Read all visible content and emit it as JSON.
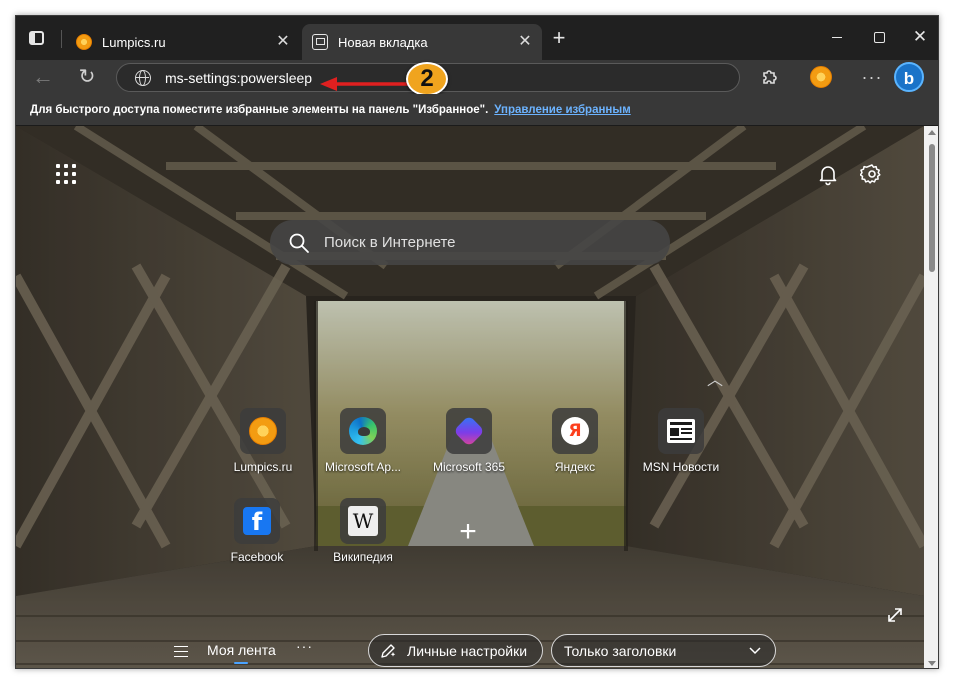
{
  "tabs": [
    {
      "title": "Lumpics.ru",
      "close": "✕",
      "favicon": "orange-icon"
    },
    {
      "title": "Новая вкладка",
      "close": "✕",
      "favicon": "new-tab-icon",
      "active": true
    }
  ],
  "toolbar": {
    "address_value": "ms-settings:powersleep",
    "annotation_number": "2",
    "annotation_color": "#f0a41e",
    "arrow_color": "#e02020",
    "bing_label": "b",
    "more_label": "···"
  },
  "favorites_bar": {
    "message": "Для быстрого доступа поместите избранные элементы на панель \"Избранное\".",
    "link": "Управление избранным"
  },
  "new_tab": {
    "search_placeholder": "Поиск в Интернете",
    "quick_links": [
      {
        "label": "Lumpics.ru",
        "icon": "orange-icon"
      },
      {
        "label": "Microsoft Ap...",
        "icon": "edge-icon"
      },
      {
        "label": "Microsoft 365",
        "icon": "microsoft-365-icon"
      },
      {
        "label": "Яндекс",
        "icon": "yandex-icon",
        "glyph": "Я"
      },
      {
        "label": "MSN Новости",
        "icon": "msn-news-icon"
      },
      {
        "label": "Facebook",
        "icon": "facebook-icon",
        "glyph": "f"
      },
      {
        "label": "Википедия",
        "icon": "wikipedia-icon",
        "glyph": "W"
      }
    ],
    "add_site": "+",
    "feed": {
      "menu_label": "Моя лента",
      "more": "···",
      "personalize": "Личные настройки",
      "layout": "Только заголовки"
    }
  },
  "colors": {
    "chrome_dark": "#202020",
    "toolbar": "#383838",
    "link": "#6cb3ff",
    "accent_blue": "#4aa3ff"
  }
}
